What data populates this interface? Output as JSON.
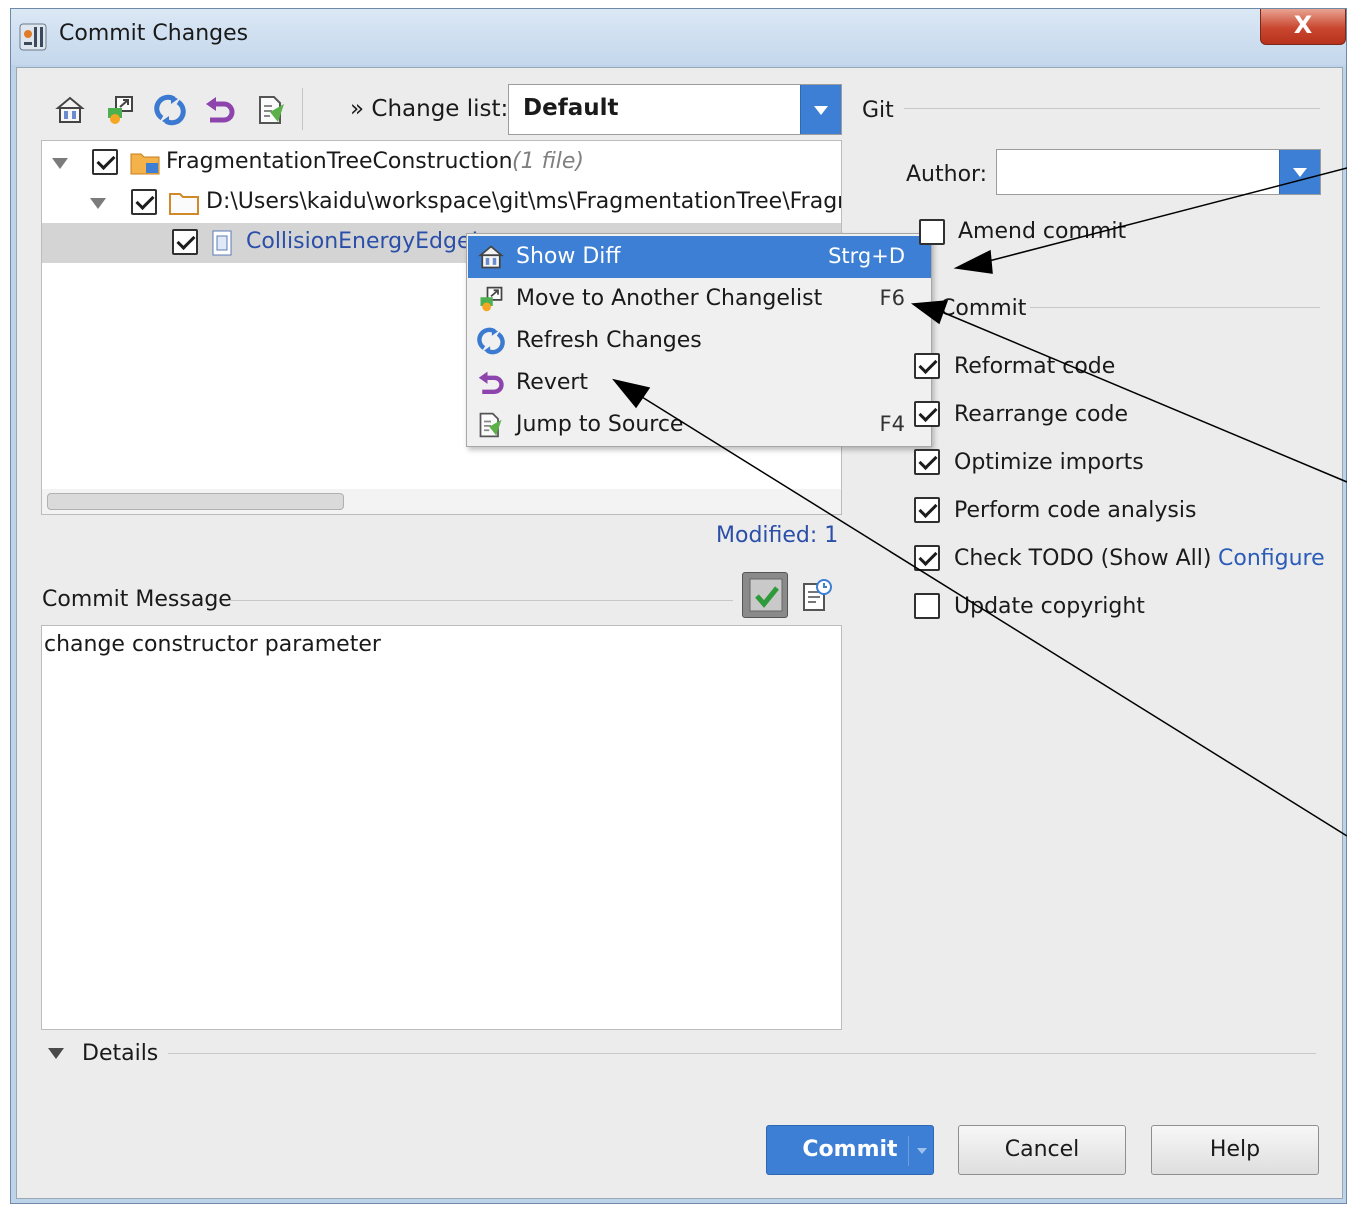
{
  "window": {
    "title": "Commit Changes",
    "close_label": "X"
  },
  "toolbar": {
    "icons": [
      "show-diff-icon",
      "move-changelist-icon",
      "refresh-icon",
      "revert-icon",
      "jump-to-source-icon"
    ],
    "changelist_label": "» Change list:",
    "changelist_value": "Default"
  },
  "tree": {
    "root": {
      "label": "FragmentationTreeConstruction",
      "count": "(1 file)",
      "checked": true
    },
    "folder": {
      "label": "D:\\Users\\kaidu\\workspace\\git\\ms\\FragmentationTree\\Fragr",
      "checked": true
    },
    "file": {
      "label": "CollisionEnergyEdge!",
      "checked": true,
      "color": "#2b4fa8"
    }
  },
  "context_menu": {
    "items": [
      {
        "label": "Show Diff",
        "shortcut": "Strg+D",
        "icon": "show-diff-icon",
        "selected": true
      },
      {
        "label": "Move to Another Changelist",
        "shortcut": "F6",
        "icon": "move-changelist-icon",
        "selected": false
      },
      {
        "label": "Refresh Changes",
        "shortcut": "",
        "icon": "refresh-icon",
        "selected": false
      },
      {
        "label": "Revert",
        "shortcut": "",
        "icon": "revert-icon",
        "selected": false
      },
      {
        "label": "Jump to Source",
        "shortcut": "F4",
        "icon": "jump-to-source-icon",
        "selected": false
      }
    ]
  },
  "status": {
    "modified": "Modified: 1"
  },
  "commit_message": {
    "label": "Commit Message",
    "text": "change constructor parameter"
  },
  "details": {
    "label": "Details"
  },
  "git": {
    "section_label": "Git",
    "author_label": "Author:",
    "author_value": "",
    "amend_label": "Amend commit",
    "amend_checked": false
  },
  "before_commit": {
    "section_label": "Commit",
    "options": [
      {
        "label": "Reformat code",
        "checked": true
      },
      {
        "label": "Rearrange code",
        "checked": true
      },
      {
        "label": "Optimize imports",
        "checked": true
      },
      {
        "label": "Perform code analysis",
        "checked": true
      },
      {
        "label": "Check TODO (Show All)",
        "checked": true
      },
      {
        "label": "Update copyright",
        "checked": false
      }
    ],
    "configure_link": "Configure"
  },
  "buttons": {
    "commit": "Commit",
    "cancel": "Cancel",
    "help": "Help"
  },
  "colors": {
    "accent": "#3d7fd4",
    "link": "#2b5cb8",
    "title_bar": "#c4d7ec",
    "close_button": "#c9462f"
  }
}
